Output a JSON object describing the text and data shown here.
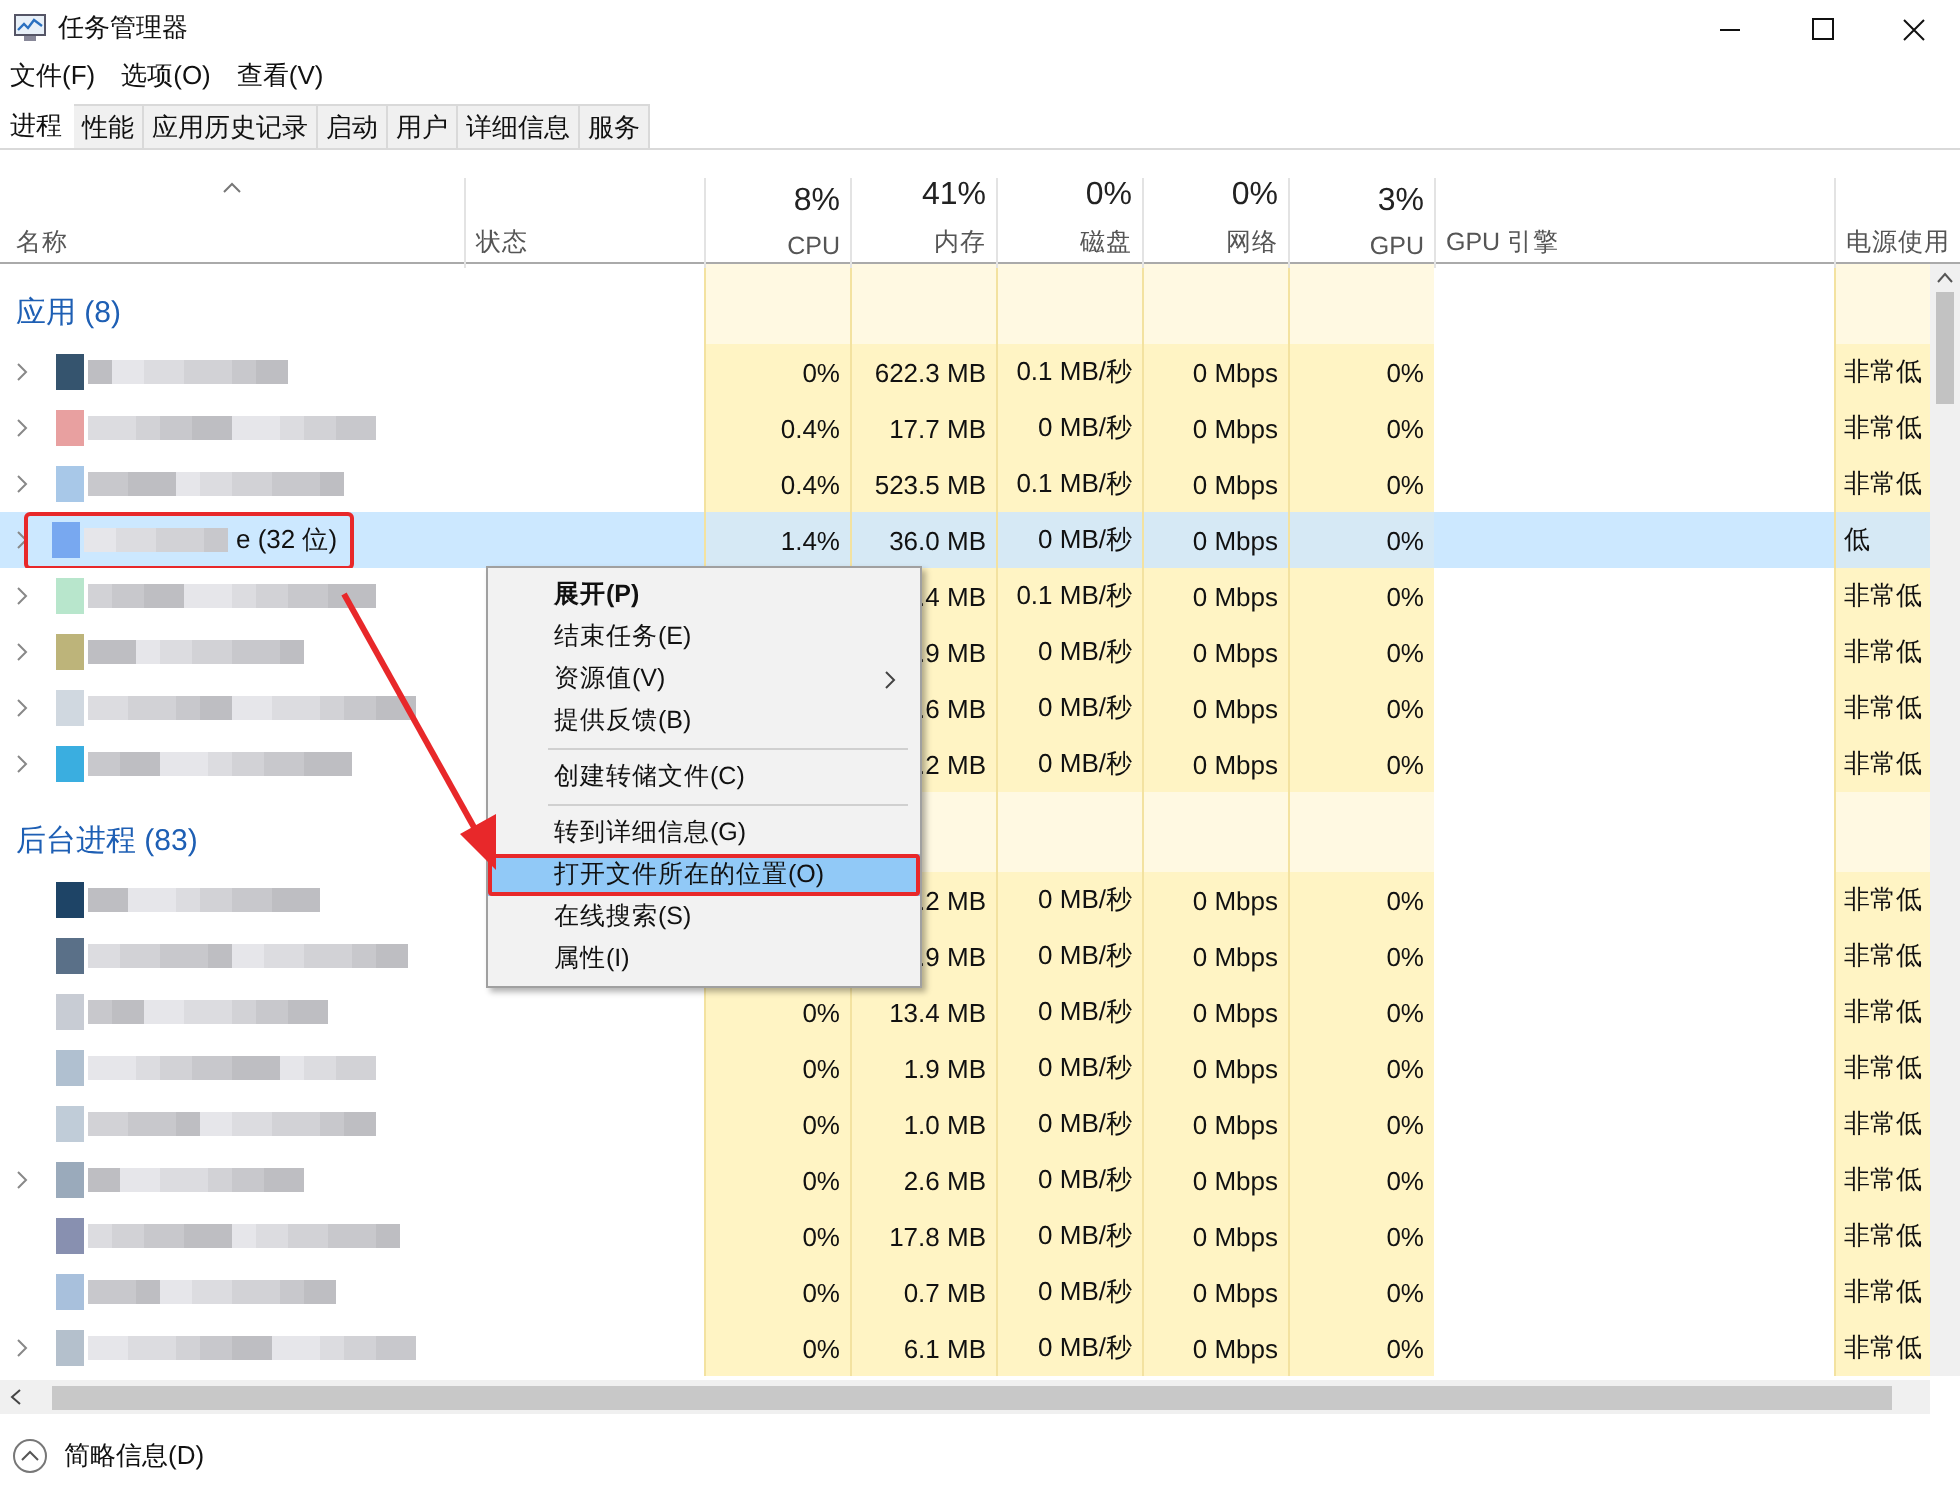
{
  "window": {
    "title": "任务管理器"
  },
  "menubar": [
    "文件(F)",
    "选项(O)",
    "查看(V)"
  ],
  "tabs": [
    {
      "label": "进程",
      "selected": true
    },
    {
      "label": "性能",
      "selected": false
    },
    {
      "label": "应用历史记录",
      "selected": false
    },
    {
      "label": "启动",
      "selected": false
    },
    {
      "label": "用户",
      "selected": false
    },
    {
      "label": "详细信息",
      "selected": false
    },
    {
      "label": "服务",
      "selected": false
    }
  ],
  "columns": [
    {
      "label": "名称",
      "sorted": true
    },
    {
      "label": "状态",
      "sorted": false
    },
    {
      "label": "CPU",
      "percent": "8%",
      "sorted": false
    },
    {
      "label": "内存",
      "percent": "41%",
      "sorted": false
    },
    {
      "label": "磁盘",
      "percent": "0%",
      "sorted": false
    },
    {
      "label": "网络",
      "percent": "0%",
      "sorted": false
    },
    {
      "label": "GPU",
      "percent": "3%",
      "sorted": false
    },
    {
      "label": "GPU 引擎",
      "sorted": false
    },
    {
      "label": "电源使用",
      "sorted": false
    }
  ],
  "groups": [
    {
      "title": "应用 (8)",
      "rows": [
        {
          "color": "#35546e",
          "expandable": true,
          "selected": false,
          "annotated": false,
          "cpu": "0%",
          "memory": "622.3 MB",
          "disk": "0.1 MB/秒",
          "network": "0 Mbps",
          "gpu": "0%",
          "power": "非常低"
        },
        {
          "color": "#e8a0a0",
          "expandable": true,
          "selected": false,
          "annotated": false,
          "cpu": "0.4%",
          "memory": "17.7 MB",
          "disk": "0 MB/秒",
          "network": "0 Mbps",
          "gpu": "0%",
          "power": "非常低"
        },
        {
          "color": "#a8c8e8",
          "expandable": true,
          "selected": false,
          "annotated": false,
          "cpu": "0.4%",
          "memory": "523.5 MB",
          "disk": "0.1 MB/秒",
          "network": "0 Mbps",
          "gpu": "0%",
          "power": "非常低"
        },
        {
          "name": "e (32 位)",
          "color": "#78a8f0",
          "expandable": true,
          "selected": true,
          "annotated": true,
          "cpu": "1.4%",
          "memory": "36.0 MB",
          "disk": "0 MB/秒",
          "network": "0 Mbps",
          "gpu": "0%",
          "power": "低"
        },
        {
          "color": "#b8e6cc",
          "expandable": true,
          "selected": false,
          "annotated": false,
          "memory": ".4 MB",
          "disk": "0.1 MB/秒",
          "network": "0 Mbps",
          "gpu": "0%",
          "power": "非常低"
        },
        {
          "color": "#bdb47a",
          "expandable": true,
          "selected": false,
          "annotated": false,
          "memory": ".9 MB",
          "disk": "0 MB/秒",
          "network": "0 Mbps",
          "gpu": "0%",
          "power": "非常低"
        },
        {
          "color": "#d0d8e0",
          "expandable": true,
          "selected": false,
          "annotated": false,
          "memory": ".6 MB",
          "disk": "0 MB/秒",
          "network": "0 Mbps",
          "gpu": "0%",
          "power": "非常低"
        },
        {
          "color": "#3aaee0",
          "expandable": true,
          "selected": false,
          "annotated": false,
          "memory": ".2 MB",
          "disk": "0 MB/秒",
          "network": "0 Mbps",
          "gpu": "0%",
          "power": "非常低"
        }
      ]
    },
    {
      "title": "后台进程 (83)",
      "rows": [
        {
          "color": "#1e4466",
          "expandable": false,
          "selected": false,
          "annotated": false,
          "memory": ".2 MB",
          "disk": "0 MB/秒",
          "network": "0 Mbps",
          "gpu": "0%",
          "power": "非常低"
        },
        {
          "color": "#5a7088",
          "expandable": false,
          "selected": false,
          "annotated": false,
          "memory": ".9 MB",
          "disk": "0 MB/秒",
          "network": "0 Mbps",
          "gpu": "0%",
          "power": "非常低"
        },
        {
          "color": "#c8ccd4",
          "expandable": false,
          "selected": false,
          "annotated": false,
          "cpu": "0%",
          "memory": "13.4 MB",
          "disk": "0 MB/秒",
          "network": "0 Mbps",
          "gpu": "0%",
          "power": "非常低"
        },
        {
          "color": "#b0c0d0",
          "expandable": false,
          "selected": false,
          "annotated": false,
          "cpu": "0%",
          "memory": "1.9 MB",
          "disk": "0 MB/秒",
          "network": "0 Mbps",
          "gpu": "0%",
          "power": "非常低"
        },
        {
          "color": "#c0ccd8",
          "expandable": false,
          "selected": false,
          "annotated": false,
          "cpu": "0%",
          "memory": "1.0 MB",
          "disk": "0 MB/秒",
          "network": "0 Mbps",
          "gpu": "0%",
          "power": "非常低"
        },
        {
          "color": "#9aaabb",
          "expandable": true,
          "selected": false,
          "annotated": false,
          "cpu": "0%",
          "memory": "2.6 MB",
          "disk": "0 MB/秒",
          "network": "0 Mbps",
          "gpu": "0%",
          "power": "非常低"
        },
        {
          "color": "#8890b0",
          "expandable": false,
          "selected": false,
          "annotated": false,
          "cpu": "0%",
          "memory": "17.8 MB",
          "disk": "0 MB/秒",
          "network": "0 Mbps",
          "gpu": "0%",
          "power": "非常低"
        },
        {
          "color": "#a8c0dc",
          "expandable": false,
          "selected": false,
          "annotated": false,
          "cpu": "0%",
          "memory": "0.7 MB",
          "disk": "0 MB/秒",
          "network": "0 Mbps",
          "gpu": "0%",
          "power": "非常低"
        },
        {
          "color": "#b4c0cc",
          "expandable": true,
          "selected": false,
          "annotated": false,
          "cpu": "0%",
          "memory": "6.1 MB",
          "disk": "0 MB/秒",
          "network": "0 Mbps",
          "gpu": "0%",
          "power": "非常低"
        }
      ]
    }
  ],
  "context_menu": {
    "sections": [
      [
        {
          "label": "展开(P)",
          "default": true,
          "submenu": false,
          "selected": false,
          "annotated": false
        },
        {
          "label": "结束任务(E)",
          "default": false,
          "submenu": false,
          "selected": false,
          "annotated": false
        },
        {
          "label": "资源值(V)",
          "default": false,
          "submenu": true,
          "selected": false,
          "annotated": false
        },
        {
          "label": "提供反馈(B)",
          "default": false,
          "submenu": false,
          "selected": false,
          "annotated": false
        }
      ],
      [
        {
          "label": "创建转储文件(C)",
          "default": false,
          "submenu": false,
          "selected": false,
          "annotated": false
        }
      ],
      [
        {
          "label": "转到详细信息(G)",
          "default": false,
          "submenu": false,
          "selected": false,
          "annotated": false
        },
        {
          "label": "打开文件所在的位置(O)",
          "default": false,
          "submenu": false,
          "selected": true,
          "annotated": true
        },
        {
          "label": "在线搜索(S)",
          "default": false,
          "submenu": false,
          "selected": false,
          "annotated": false
        },
        {
          "label": "属性(I)",
          "default": false,
          "submenu": false,
          "selected": false,
          "annotated": false
        }
      ]
    ]
  },
  "annotations": [
    {
      "kind": "arrow"
    }
  ],
  "footer": {
    "label": "简略信息(D)"
  }
}
